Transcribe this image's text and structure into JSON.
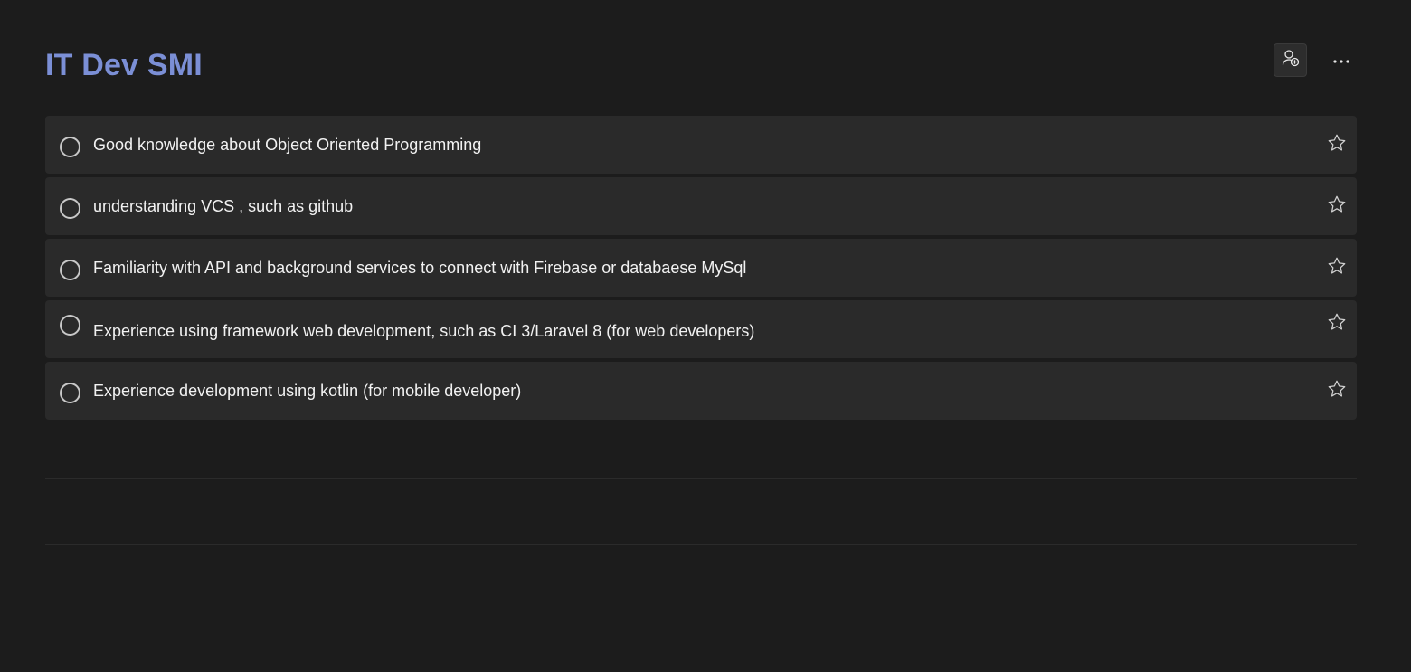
{
  "list": {
    "title": "IT Dev SMI",
    "title_color": "#7b8fd6"
  },
  "toolbar": {
    "share_icon": "person-add-icon",
    "more_icon": "more-horizontal-icon"
  },
  "tasks": [
    {
      "text": "Good knowledge about Object Oriented  Programming",
      "completed": false,
      "important": false
    },
    {
      "text": "understanding VCS , such as github",
      "completed": false,
      "important": false
    },
    {
      "text": "Familiarity with API and background services to connect with Firebase or databaese MySql",
      "completed": false,
      "important": false
    },
    {
      "text": "Experience using framework web development, such as CI 3/Laravel 8 (for web developers)",
      "completed": false,
      "important": false
    },
    {
      "text": "Experience development using kotlin (for mobile developer)",
      "completed": false,
      "important": false
    }
  ],
  "colors": {
    "background": "#1c1c1c",
    "task_background": "#2a2a2a",
    "text": "#f2f2f2"
  }
}
